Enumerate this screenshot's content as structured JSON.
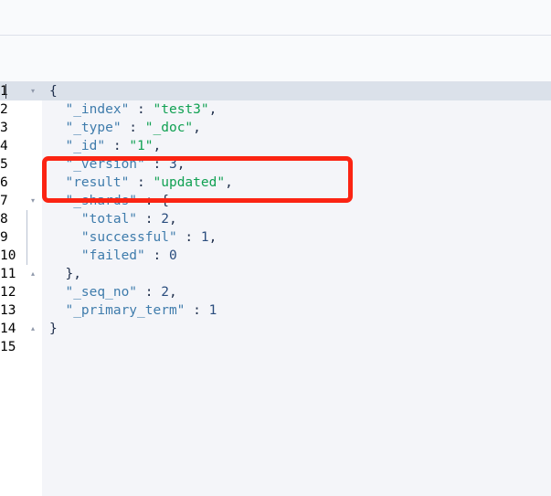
{
  "window": {
    "background_color": "#f9fafc",
    "divider_color": "#dde1ea"
  },
  "editor": {
    "name": "json-response-viewer",
    "background_color": "#f4f5f9",
    "gutter_background_color": "#ffffff",
    "active_line": 1,
    "active_line_color": "#dbe1ea",
    "total_lines": 15,
    "syntax_colors": {
      "key": "#3f7cac",
      "string": "#11a153",
      "number": "#2a4d7e",
      "punctuation": "#20304d",
      "line_number": "#8a93a8",
      "active_line_number": "#b08a5c"
    },
    "lines": [
      {
        "number": "1",
        "fold": "▾",
        "tokens": [
          {
            "t": "punct",
            "v": "{"
          }
        ]
      },
      {
        "number": "2",
        "fold": "",
        "tokens": [
          {
            "t": "punct",
            "v": "  "
          },
          {
            "t": "key",
            "v": "\"_index\""
          },
          {
            "t": "punct",
            "v": " : "
          },
          {
            "t": "str",
            "v": "\"test3\""
          },
          {
            "t": "punct",
            "v": ","
          }
        ]
      },
      {
        "number": "3",
        "fold": "",
        "tokens": [
          {
            "t": "punct",
            "v": "  "
          },
          {
            "t": "key",
            "v": "\"_type\""
          },
          {
            "t": "punct",
            "v": " : "
          },
          {
            "t": "str",
            "v": "\"_doc\""
          },
          {
            "t": "punct",
            "v": ","
          }
        ]
      },
      {
        "number": "4",
        "fold": "",
        "tokens": [
          {
            "t": "punct",
            "v": "  "
          },
          {
            "t": "key",
            "v": "\"_id\""
          },
          {
            "t": "punct",
            "v": " : "
          },
          {
            "t": "str",
            "v": "\"1\""
          },
          {
            "t": "punct",
            "v": ","
          }
        ]
      },
      {
        "number": "5",
        "fold": "",
        "tokens": [
          {
            "t": "punct",
            "v": "  "
          },
          {
            "t": "key",
            "v": "\"_version\""
          },
          {
            "t": "punct",
            "v": " : "
          },
          {
            "t": "num",
            "v": "3"
          },
          {
            "t": "punct",
            "v": ","
          }
        ]
      },
      {
        "number": "6",
        "fold": "",
        "tokens": [
          {
            "t": "punct",
            "v": "  "
          },
          {
            "t": "key",
            "v": "\"result\""
          },
          {
            "t": "punct",
            "v": " : "
          },
          {
            "t": "str",
            "v": "\"updated\""
          },
          {
            "t": "punct",
            "v": ","
          }
        ]
      },
      {
        "number": "7",
        "fold": "▾",
        "tokens": [
          {
            "t": "punct",
            "v": "  "
          },
          {
            "t": "key",
            "v": "\"_shards\""
          },
          {
            "t": "punct",
            "v": " : {"
          }
        ]
      },
      {
        "number": "8",
        "fold": "",
        "tokens": [
          {
            "t": "punct",
            "v": "    "
          },
          {
            "t": "key",
            "v": "\"total\""
          },
          {
            "t": "punct",
            "v": " : "
          },
          {
            "t": "num",
            "v": "2"
          },
          {
            "t": "punct",
            "v": ","
          }
        ]
      },
      {
        "number": "9",
        "fold": "",
        "tokens": [
          {
            "t": "punct",
            "v": "    "
          },
          {
            "t": "key",
            "v": "\"successful\""
          },
          {
            "t": "punct",
            "v": " : "
          },
          {
            "t": "num",
            "v": "1"
          },
          {
            "t": "punct",
            "v": ","
          }
        ]
      },
      {
        "number": "10",
        "fold": "",
        "tokens": [
          {
            "t": "punct",
            "v": "    "
          },
          {
            "t": "key",
            "v": "\"failed\""
          },
          {
            "t": "punct",
            "v": " : "
          },
          {
            "t": "num",
            "v": "0"
          }
        ]
      },
      {
        "number": "11",
        "fold": "▴",
        "tokens": [
          {
            "t": "punct",
            "v": "  },"
          }
        ]
      },
      {
        "number": "12",
        "fold": "",
        "tokens": [
          {
            "t": "punct",
            "v": "  "
          },
          {
            "t": "key",
            "v": "\"_seq_no\""
          },
          {
            "t": "punct",
            "v": " : "
          },
          {
            "t": "num",
            "v": "2"
          },
          {
            "t": "punct",
            "v": ","
          }
        ]
      },
      {
        "number": "13",
        "fold": "",
        "tokens": [
          {
            "t": "punct",
            "v": "  "
          },
          {
            "t": "key",
            "v": "\"_primary_term\""
          },
          {
            "t": "punct",
            "v": " : "
          },
          {
            "t": "num",
            "v": "1"
          }
        ]
      },
      {
        "number": "14",
        "fold": "▴",
        "tokens": [
          {
            "t": "punct",
            "v": "}"
          }
        ]
      },
      {
        "number": "15",
        "fold": "",
        "tokens": []
      }
    ]
  },
  "annotation": {
    "type": "rectangle-highlight",
    "color": "#fb2413",
    "covers_lines": "5-6",
    "covers_text": "\"_version\" : 3, \"result\" : \"updated\","
  },
  "document": {
    "_index": "test3",
    "_type": "_doc",
    "_id": "1",
    "_version": 3,
    "result": "updated",
    "_shards": {
      "total": 2,
      "successful": 1,
      "failed": 0
    },
    "_seq_no": 2,
    "_primary_term": 1
  }
}
